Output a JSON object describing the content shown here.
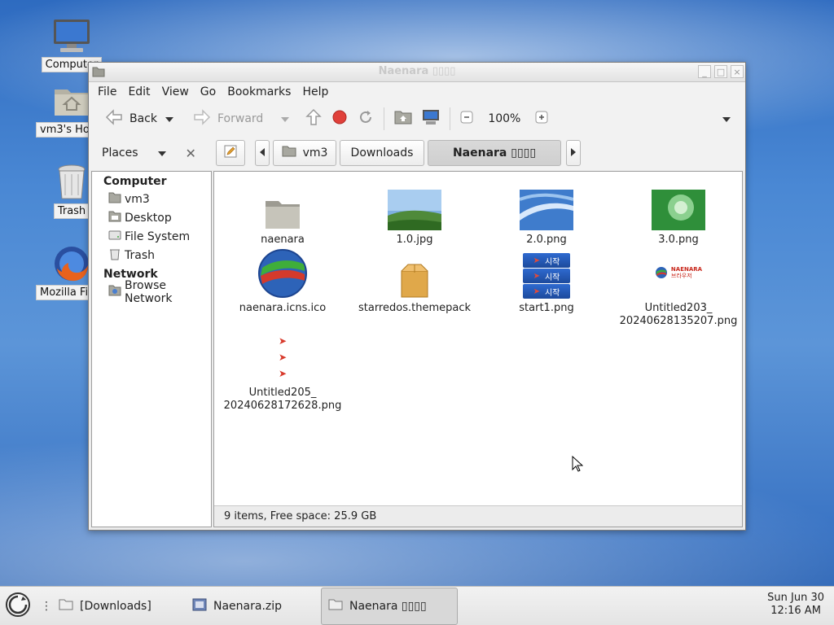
{
  "desktop": {
    "icons": [
      {
        "label": "Computer",
        "icon": "computer-icon"
      },
      {
        "label": "vm3's Home",
        "icon": "home-folder-icon"
      },
      {
        "label": "Trash",
        "icon": "trash-icon"
      },
      {
        "label": "Mozilla Firefox",
        "icon": "firefox-icon"
      }
    ]
  },
  "window": {
    "title": "Naenara ▯▯▯▯",
    "menu": [
      "File",
      "Edit",
      "View",
      "Go",
      "Bookmarks",
      "Help"
    ],
    "toolbar": {
      "back": "Back",
      "forward": "Forward",
      "zoom": "100%"
    },
    "places_label": "Places",
    "breadcrumbs": [
      {
        "label": "vm3",
        "icon": "home-icon"
      },
      {
        "label": "Downloads"
      },
      {
        "label": "Naenara ▯▯▯▯"
      }
    ],
    "sidebar": {
      "computer_header": "Computer",
      "computer_items": [
        "vm3",
        "Desktop",
        "File System",
        "Trash"
      ],
      "network_header": "Network",
      "network_items": [
        "Browse Network"
      ]
    },
    "files": [
      {
        "name": "naenara",
        "type": "folder"
      },
      {
        "name": "1.0.jpg",
        "type": "image"
      },
      {
        "name": "2.0.png",
        "type": "image"
      },
      {
        "name": "3.0.png",
        "type": "image"
      },
      {
        "name": "naenara.icns.ico",
        "type": "icon"
      },
      {
        "name": "starredos.themepack",
        "type": "package"
      },
      {
        "name": "start1.png",
        "type": "image"
      },
      {
        "name": "Untitled203_\n20240628135207.png",
        "type": "image"
      },
      {
        "name": "Untitled205_\n20240628172628.png",
        "type": "image"
      }
    ],
    "thumb_texts": {
      "start1": "시작",
      "naenara_logo_top": "NAENARA",
      "naenara_logo_bottom": "브라우저"
    },
    "status": "9 items, Free space: 25.9 GB"
  },
  "taskbar": {
    "tasks": [
      {
        "label": "[Downloads]",
        "icon": "folder-icon"
      },
      {
        "label": "Naenara.zip",
        "icon": "archive-icon"
      },
      {
        "label": "Naenara ▯▯▯▯",
        "icon": "folder-icon"
      }
    ],
    "clock_date": "Sun Jun 30",
    "clock_time": "12:16 AM"
  },
  "colors": {
    "accent_red": "#d83a2c",
    "folder_gray": "#a8a8a0",
    "desktop_blue": "#3f7ccc"
  }
}
